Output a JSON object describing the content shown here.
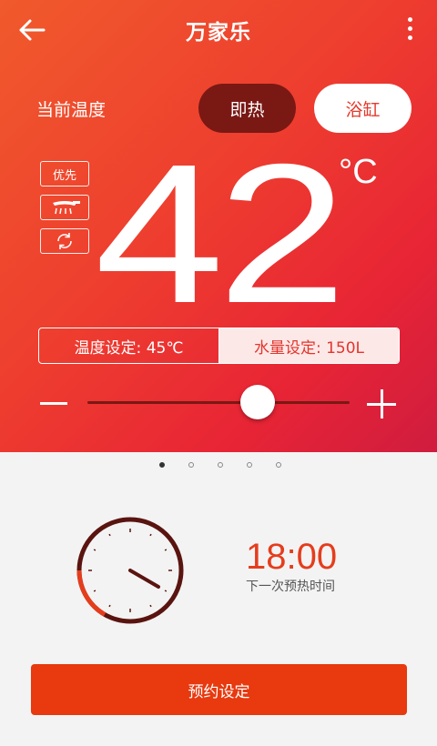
{
  "header": {
    "title": "万家乐",
    "back_icon": "arrow-left-icon",
    "menu_icon": "more-vertical-icon"
  },
  "current_temp": {
    "label": "当前温度",
    "value": "42",
    "unit": "°C"
  },
  "modes": {
    "instant_label": "即热",
    "bath_label": "浴缸",
    "selected": "即热"
  },
  "side_icons": {
    "priority_label": "优先",
    "shower_icon": "shower-icon",
    "cycle_icon": "cycle-icon"
  },
  "settings": {
    "temp_setting": "温度设定: 45℃",
    "water_setting": "水量设定: 150L"
  },
  "slider": {
    "level": 0.65,
    "minus_icon": "minus-icon",
    "plus_icon": "plus-icon"
  },
  "pager": {
    "count": 5,
    "active_index": 0
  },
  "schedule": {
    "time": "18:00",
    "label": "下一次预热时间",
    "button_label": "预约设定"
  },
  "colors": {
    "accent": "#e8390f",
    "mode_active": "#7a1814",
    "clock_ring": "#5a1410",
    "clock_progress": "#e53d1c"
  }
}
